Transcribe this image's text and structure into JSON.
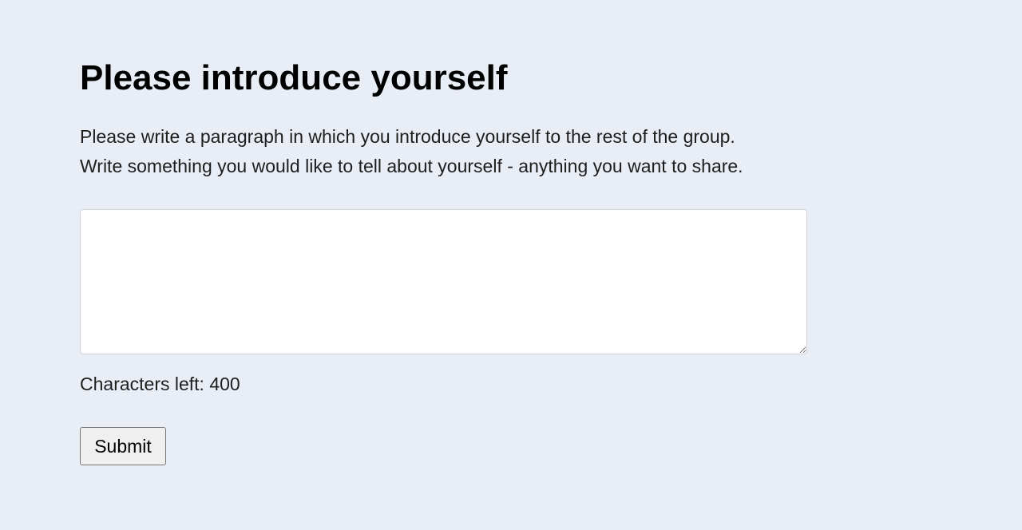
{
  "page": {
    "title": "Please introduce yourself",
    "instructions": {
      "line1": "Please write a paragraph in which you introduce yourself to the rest of the group.",
      "line2": "Write something you would like to tell about yourself - anything you want to share."
    }
  },
  "form": {
    "textarea": {
      "value": "",
      "placeholder": ""
    },
    "counter_label": "Characters left: 400",
    "submit_label": "Submit"
  },
  "colors": {
    "background": "#e9edf5",
    "textarea_bg": "#ffffff",
    "button_bg": "#efefef"
  }
}
